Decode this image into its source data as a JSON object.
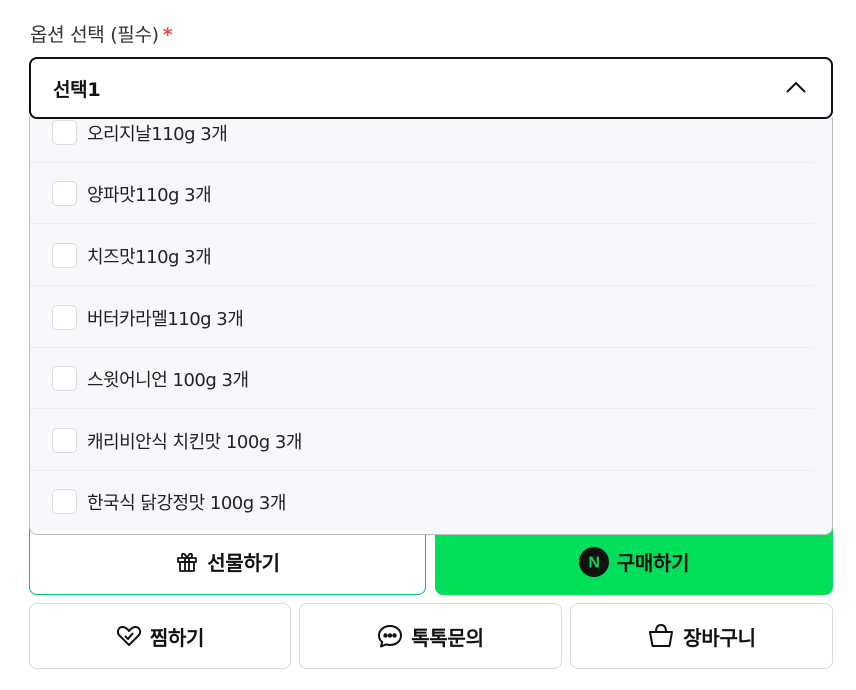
{
  "option_section": {
    "label": "옵션 선택 (필수)",
    "required_mark": "*",
    "required_color": "#f04b3f",
    "selected_value": "선택1",
    "expanded": true,
    "options": [
      {
        "label": "오리지날110g 3개",
        "checked": false
      },
      {
        "label": "양파맛110g 3개",
        "checked": false
      },
      {
        "label": "치즈맛110g 3개",
        "checked": false
      },
      {
        "label": "버터카라멜110g 3개",
        "checked": false
      },
      {
        "label": "스윗어니언 100g 3개",
        "checked": false
      },
      {
        "label": "캐리비안식 치킨맛 100g 3개",
        "checked": false
      },
      {
        "label": "한국식 닭강정맛 100g 3개",
        "checked": false
      }
    ]
  },
  "actions": {
    "gift": {
      "label": "선물하기",
      "icon": "gift-icon"
    },
    "buy": {
      "label": "구매하기",
      "icon": "naver-n-icon",
      "icon_text": "N",
      "color": "#00de5a"
    },
    "wish": {
      "label": "찜하기",
      "icon": "heart-icon"
    },
    "talk": {
      "label": "톡톡문의",
      "icon": "chat-bubble-icon"
    },
    "cart": {
      "label": "장바구니",
      "icon": "basket-icon"
    }
  }
}
